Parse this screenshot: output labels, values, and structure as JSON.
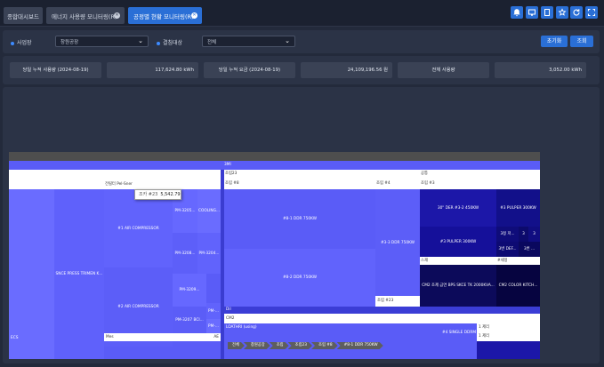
{
  "tabs": [
    {
      "label": "종합대시보드",
      "active": false,
      "closable": false
    },
    {
      "label": "에너지 사용량 모니터링(R)",
      "active": false,
      "closable": true
    },
    {
      "label": "공정별 현황 모니터링(R)",
      "active": true,
      "closable": true
    }
  ],
  "toolbar_icons": [
    "bell-icon",
    "monitor-icon",
    "tablet-icon",
    "star-icon",
    "refresh-icon",
    "fullscreen-icon"
  ],
  "filter": {
    "site_label": "사업장",
    "site_value": "창원공장",
    "target_label": "결침대상",
    "target_value": "전체",
    "reset_label": "초기화",
    "search_label": "조회"
  },
  "summary": [
    {
      "label": "당일 누적 사용량 (2024-08-19)",
      "value": "117,624.80 kWh"
    },
    {
      "label": "당일 누적 요금 (2024-08-19)",
      "value": "24,109,196.56 원"
    },
    {
      "label": "전체 사용량",
      "value": "3,052.00 kWh"
    }
  ],
  "treemap": {
    "root_label": "3MI",
    "groups": {
      "g1_header": "전릴터   Pel-Sner",
      "g1_sub": "전릴터",
      "g2_header": "조립23",
      "g2_sub1": "조립 #8",
      "g2_sub2": "조립 #4",
      "g3_header": "공통",
      "g3_sub": "조립 #3",
      "g4_header": "Dil",
      "g4_sub1": "CM2",
      "g4_sub2": "LOATHRI (using)"
    },
    "labels": {
      "press": "SNCE PRESS TRIMEN K...",
      "ecs": "ECS",
      "air1": "#1 AIR COMPRESSOR",
      "air2": "#2 AIR COMPRESSOR",
      "pm3205": "PM-3205...",
      "cooling": "COOLING...",
      "pm3208": "PM-3208...",
      "pm3204": "PM-3204...",
      "pm3209": "PM-3209...",
      "pm3207": "PM-3207 BCI...",
      "pm_a": "PM-...",
      "pm_b": "PM-...",
      "mes": "Mes",
      "ae": "AE",
      "ddr1": "#8-1 DDR 750KW",
      "ddr2": "#8-2 DDR 750KW",
      "ddr3": "#3-3 DDR 750KW",
      "sub23": "조립 #23",
      "c1": "30\" DER #3-2 450KW",
      "c2": "#3 PULPER 300KW",
      "c3": "#3 PULPER 300KW",
      "c4": "3정 저...",
      "c5": "3",
      "c6": "3번 DEF...",
      "c7": "3번 ...",
      "c8": "스재",
      "c9": "#세정",
      "cm1": "CM2 조제 급연 BPS SKCE TK 2000KVA...",
      "cm2": "CM2 COLOR KITCH...",
      "sg": "#4 SINGLE DDRM",
      "sw1": "1 제리",
      "sw2": "1 제리"
    },
    "tooltip": {
      "name": "조카 #23",
      "value": "5,542.79"
    },
    "breadcrumb": [
      "전체",
      "창원공장",
      "조립",
      "조립23",
      "조립 #8",
      "#8-1 DDR 750KW"
    ]
  }
}
